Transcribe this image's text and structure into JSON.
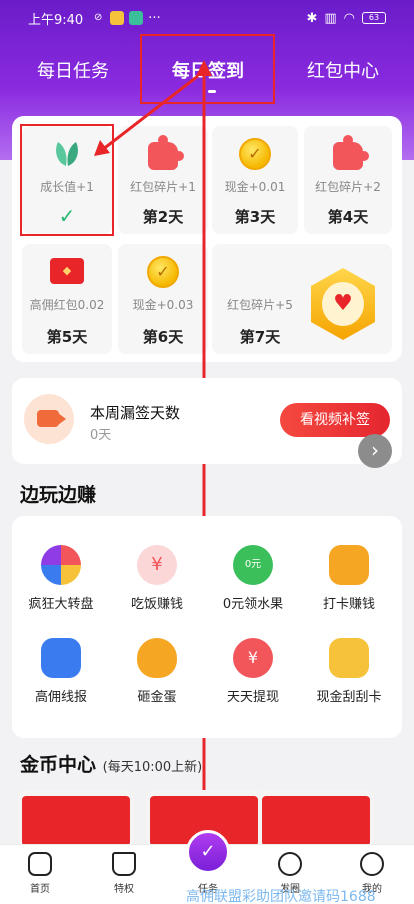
{
  "status_bar": {
    "time": "上午9:40",
    "battery": "63"
  },
  "tabs": [
    {
      "label": "每日任务"
    },
    {
      "label": "每日签到"
    },
    {
      "label": "红包中心"
    }
  ],
  "checkin": {
    "days": [
      {
        "reward": "成长值+1",
        "label": "",
        "checked": true,
        "icon": "leaf-icon"
      },
      {
        "reward": "红包碎片+1",
        "label": "第2天",
        "icon": "puzzle-icon"
      },
      {
        "reward": "现金+0.01",
        "label": "第3天",
        "icon": "coin-icon"
      },
      {
        "reward": "红包碎片+2",
        "label": "第4天",
        "icon": "puzzle-icon"
      },
      {
        "reward": "高佣红包0.02",
        "label": "第5天",
        "icon": "red-packet-icon"
      },
      {
        "reward": "现金+0.03",
        "label": "第6天",
        "icon": "coin-icon"
      },
      {
        "reward": "红包碎片+5",
        "label": "第7天",
        "icon": "red-packet-badge-icon"
      }
    ],
    "check_mark": "✓"
  },
  "makeup": {
    "title": "本周漏签天数",
    "count": "0天",
    "button": "看视频补签"
  },
  "play_earn": {
    "title": "边玩边赚",
    "items": [
      {
        "label": "疯狂大转盘",
        "icon": "wheel-icon",
        "color": "#8f3be6"
      },
      {
        "label": "吃饭赚钱",
        "icon": "bowl-icon",
        "color": "#f2555a"
      },
      {
        "label": "0元领水果",
        "icon": "fruit-icon",
        "color": "#3bbf5a"
      },
      {
        "label": "打卡赚钱",
        "icon": "calendar-icon",
        "color": "#f5a623"
      },
      {
        "label": "高佣线报",
        "icon": "news-icon",
        "color": "#3a7cf0"
      },
      {
        "label": "砸金蛋",
        "icon": "golden-egg-icon",
        "color": "#f5a623"
      },
      {
        "label": "天天提现",
        "icon": "money-bag-icon",
        "color": "#f2555a"
      },
      {
        "label": "现金刮刮卡",
        "icon": "scratch-card-icon",
        "color": "#f5c23a"
      }
    ]
  },
  "coin_center": {
    "title": "金币中心",
    "subtitle": "(每天10:00上新)"
  },
  "bottom_nav": [
    {
      "label": "首页",
      "icon": "home-icon"
    },
    {
      "label": "特权",
      "icon": "crown-icon"
    },
    {
      "label": "任务",
      "icon": "task-icon"
    },
    {
      "label": "发圈",
      "icon": "share-circle-icon"
    },
    {
      "label": "我的",
      "icon": "profile-icon"
    }
  ],
  "watermark": "高佣联盟彩助团队邀请码1688",
  "colors": {
    "accent": "#8a2ae0",
    "annotation": "#e8262a",
    "button": "#e5262f"
  }
}
